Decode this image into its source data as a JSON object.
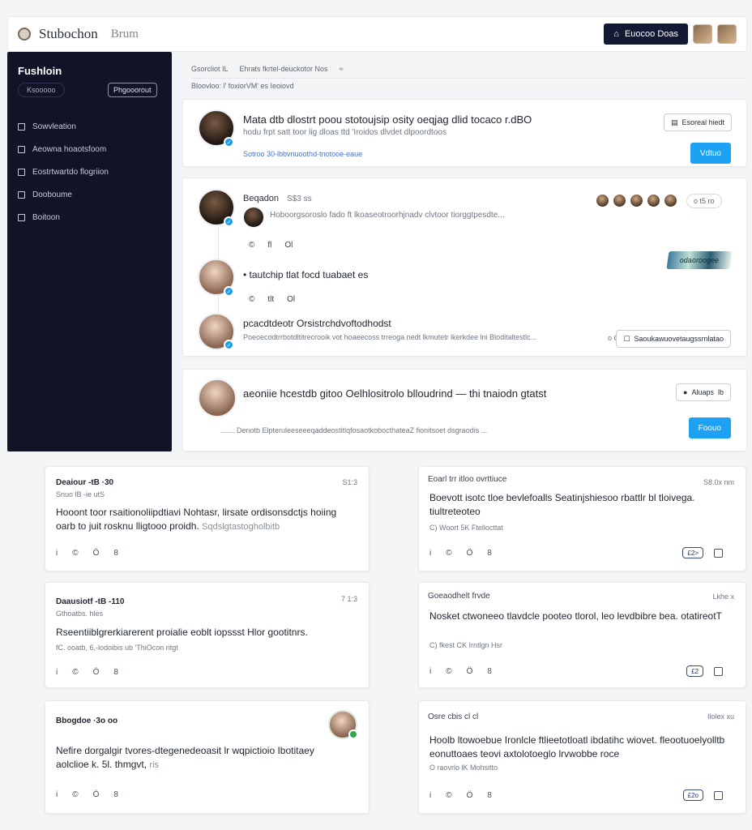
{
  "topbar": {
    "title": "Stubochon",
    "subtitle": "Brum",
    "button_label": "Euocoo Doas"
  },
  "sidebar": {
    "title": "Fushloin",
    "pill_left": "Ksooooo",
    "pill_right": "Phgooorout",
    "items": [
      {
        "label": "Sowvleation"
      },
      {
        "label": "Aeowna hoaotsfoom"
      },
      {
        "label": "Eostrtwartdo flogriion"
      },
      {
        "label": "Dooboume"
      },
      {
        "label": "Boitoon"
      }
    ]
  },
  "breadcrumb": {
    "row1": [
      "Gsorcliot  IL",
      "Ehrats fkrtel-deuckotor  Nos",
      "≈"
    ],
    "row2": "Bloovloo: l' foxiorVM' es Ieoiovd"
  },
  "post1": {
    "title": "Mata dtb dlostrt poou stotoujsip osity oeqjag dlid tocaco r.dBO",
    "subtitle": "hodu frpt satt toor lig dloas ttd 'Iroidos dlvdet dlpoordtoos",
    "meta": "Sotroo 30-lbbvnuoothd-tnotooe-eaue",
    "outline_btn": "Esoreal hiedt",
    "blue_btn": "Vdtuo"
  },
  "post2": {
    "author": "Beqadon",
    "author_meta": "S$3 ss",
    "comment": "Hoboorgsoroslo fado ft lkoaseotroorhjnadv clvtoor tiorggtpesdte...",
    "reacts1": [
      "©",
      "fl",
      "Ol"
    ],
    "reply1": "tautchip tlat focd tuabaet es",
    "reacts2": [
      "©",
      "tlt",
      "Ol"
    ],
    "reply2_title": "pcacdtdeotr Orsistrchdvoftodhodst",
    "reply2_body": "Poeoecodtrrbotdltitrecrooik vot hoaeecoss trreoga nedt lkmutetr lkerkdee lni Bloditaltestlc...",
    "pill_top": "o t5 ro",
    "pill_count": "o C5",
    "outline_btn": "Saoukawuovetaugssrnlatao",
    "thumb_label": "odaoroogee"
  },
  "post3": {
    "title": "aeoniie hcestdb gitoo Oelhlositrolo blloudrind — thi tnaiodn gtatst",
    "subtitle": "Denotb ElpteruleeseeeqaddeostitlqfosaotkobocthateaZ fionitsoet dsgraodis ...",
    "outline_btn": "Aluaps",
    "outline_btn_icon": "lb",
    "blue_btn": "Foouo"
  },
  "grid": [
    {
      "head": "Deaiour  -tB  ·30",
      "sub": "Snuo  lB  -ie utS",
      "time": "S1:3",
      "body": "Hooont toor rsaitionoliipdtiavi Nohtasr, lirsate ordisonsdctjs hoiing oarb to juit rosknu lligtooo proidh.",
      "body_muted": "Sqdslgtastogholbitb",
      "foot": [
        "i",
        "©",
        "Ö",
        "8"
      ]
    },
    {
      "head": "Eoarl trr itloo ovrttiuce",
      "time": "S8.0x nm",
      "body": "Boevott isotc  tloe bevlefoalls  Seatinjshiesoo rbattlr bl tloivega. tiultreteoteo",
      "small": "C) Woort  5K  Ftellocttat",
      "tag": "£2>",
      "foot": [
        "i",
        "©",
        "Ö",
        "8"
      ]
    },
    {
      "head": "Daausiotf  -tB  -110",
      "sub": "Gthoatbs. hles",
      "time": "7 1:3",
      "body": "Rseentiiblgrerkiarerent proialie eoblt iopssst Hlor gootitnrs.",
      "small": "fC. ooatb,  6,-lodoibis    ub  'ThiOcon ritgt",
      "foot": [
        "i",
        "©",
        "Ö",
        "8"
      ]
    },
    {
      "head": "Goeaodhelt  frvde",
      "time": "Lkhe x",
      "body": "Nosket ctwoneeo tlavdcle pooteo tlorol,  leo levdbibre bea. otatireotT",
      "small": "C) fkest   CK  Irntlgn Hsr",
      "tag": "£2",
      "foot": [
        "i",
        "©",
        "Ö",
        "8"
      ]
    },
    {
      "head": "Bbogdoe  ·3o  oo",
      "time": "",
      "body": "Nefire dorgalgir tvores-dtegenedeoasit lr wqpictioio Ibotitaey aolclioe k. 5l. thmgvt,",
      "body_muted": "ris",
      "foot": [
        "i",
        "©",
        "Ö",
        "8"
      ]
    },
    {
      "head": "Osre cbis cl cl",
      "time": "Ilolex xu",
      "body": "Hoolb ltowoebue Ironlcle ftlieetotloatl ibdatihc wiovet. fleootuoelyolltb eonuttoaes teovi axtolotoeglo lrvwobbe roce",
      "small": "O raovrlo  lK  Mohsitto",
      "tag": "£2o",
      "foot": [
        "i",
        "©",
        "Ö",
        "8"
      ]
    }
  ],
  "colors": {
    "sidebar_bg": "#111426",
    "accent_blue": "#1da1f2",
    "dark_button": "#121a33",
    "online_green": "#2ea84a"
  }
}
